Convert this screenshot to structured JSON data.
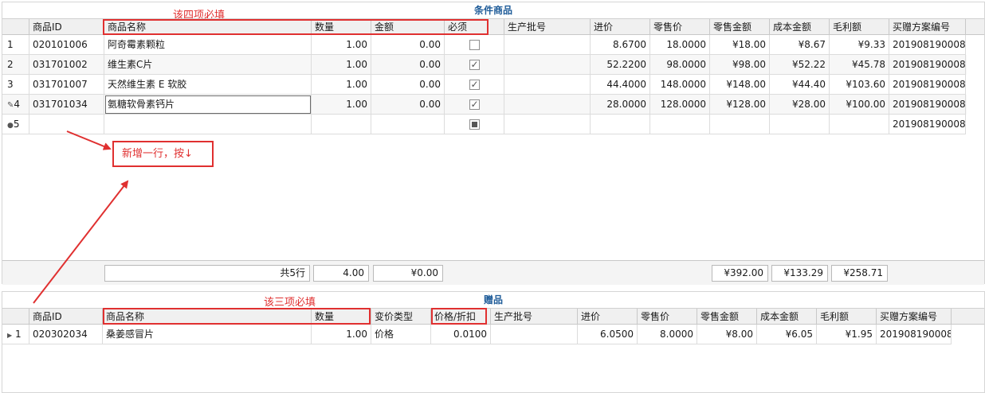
{
  "panel1": {
    "title": "条件商品",
    "annotation": "该四项必填",
    "headers": [
      "商品ID",
      "商品名称",
      "数量",
      "金额",
      "必须",
      "生产批号",
      "进价",
      "零售价",
      "零售金额",
      "成本金额",
      "毛利额",
      "买赠方案编号"
    ],
    "rows": [
      {
        "idx": "1",
        "id": "020101006",
        "name": "阿奇霉素颗粒",
        "qty": "1.00",
        "amount": "0.00",
        "required": "unchecked",
        "batch": "",
        "cost": "8.6700",
        "retail": "18.0000",
        "retail_amt": "¥18.00",
        "cost_amt": "¥8.67",
        "profit": "¥9.33",
        "plan": "201908190008"
      },
      {
        "idx": "2",
        "id": "031701002",
        "name": "维生素C片",
        "qty": "1.00",
        "amount": "0.00",
        "required": "checked",
        "batch": "",
        "cost": "52.2200",
        "retail": "98.0000",
        "retail_amt": "¥98.00",
        "cost_amt": "¥52.22",
        "profit": "¥45.78",
        "plan": "201908190008"
      },
      {
        "idx": "3",
        "id": "031701007",
        "name": "天然维生素 E 软胶",
        "qty": "1.00",
        "amount": "0.00",
        "required": "checked",
        "batch": "",
        "cost": "44.4000",
        "retail": "148.0000",
        "retail_amt": "¥148.00",
        "cost_amt": "¥44.40",
        "profit": "¥103.60",
        "plan": "201908190008"
      },
      {
        "idx": "4",
        "id": "031701034",
        "name": "氨糖软骨素钙片",
        "qty": "1.00",
        "amount": "0.00",
        "required": "checked",
        "batch": "",
        "cost": "28.0000",
        "retail": "128.0000",
        "retail_amt": "¥128.00",
        "cost_amt": "¥28.00",
        "profit": "¥100.00",
        "plan": "201908190008"
      },
      {
        "idx": "5",
        "id": "",
        "name": "",
        "qty": "",
        "amount": "",
        "required": "indeterminate",
        "batch": "",
        "cost": "",
        "retail": "",
        "retail_amt": "",
        "cost_amt": "",
        "profit": "",
        "plan": "201908190008"
      }
    ],
    "footer": {
      "count": "共5行",
      "qty_total": "4.00",
      "amount_total": "¥0.00",
      "retail_total": "¥392.00",
      "cost_total": "¥133.29",
      "profit_total": "¥258.71"
    }
  },
  "note": "新增一行，按↓",
  "panel2": {
    "title": "赠品",
    "annotation": "该三项必填",
    "headers": [
      "商品ID",
      "商品名称",
      "数量",
      "变价类型",
      "价格/折扣",
      "生产批号",
      "进价",
      "零售价",
      "零售金额",
      "成本金额",
      "毛利额",
      "买赠方案编号"
    ],
    "rows": [
      {
        "idx": "1",
        "id": "020302034",
        "name": "桑姜感冒片",
        "qty": "1.00",
        "type": "价格",
        "price": "0.0100",
        "batch": "",
        "cost": "6.0500",
        "retail": "8.0000",
        "retail_amt": "¥8.00",
        "cost_amt": "¥6.05",
        "profit": "¥1.95",
        "plan": "201908190008"
      }
    ]
  },
  "colors": {
    "annotation": "#e03030",
    "title": "#1f5c99",
    "header_bg": "#f0f0f0"
  }
}
